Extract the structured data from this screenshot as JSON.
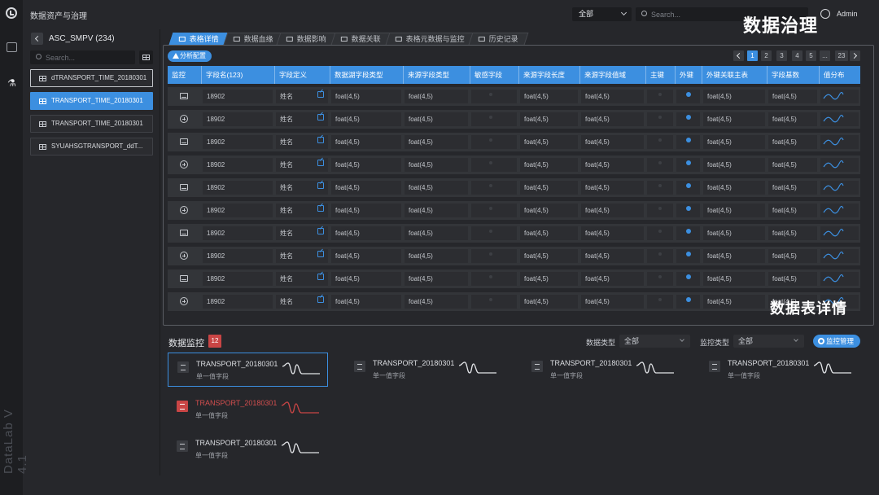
{
  "app": {
    "title": "数据资产与治理",
    "version": "DataLab V 4.1"
  },
  "header": {
    "scope": "全部",
    "search_placeholder": "Search...",
    "user": "Admin"
  },
  "overlay": {
    "title_main": "数据治理",
    "title_table": "数据表详情"
  },
  "sidebar": {
    "db_name": "ASC_SMPV (234)",
    "search_placeholder": "Search...",
    "tables": [
      {
        "name": "dTRANSPORT_TIME_20180301",
        "state": "outlined"
      },
      {
        "name": "TRANSPORT_TIME_20180301",
        "state": "selected"
      },
      {
        "name": "TRANSPORT_TIME_20180301",
        "state": "normal"
      },
      {
        "name": "SYUAHSGTRANSPORT_ddT...",
        "state": "normal"
      }
    ]
  },
  "tabs": [
    {
      "label": "表格详情",
      "active": true
    },
    {
      "label": "数据血缘",
      "active": false
    },
    {
      "label": "数据影响",
      "active": false
    },
    {
      "label": "数据关联",
      "active": false
    },
    {
      "label": "表格元数据与监控",
      "active": false
    },
    {
      "label": "历史记录",
      "active": false
    }
  ],
  "table": {
    "analyze_label": "分析配置",
    "pagination": {
      "pages": [
        "1",
        "2",
        "3",
        "4",
        "5",
        "...",
        "23"
      ],
      "current": "1"
    },
    "columns": [
      "监控",
      "字段名(123)",
      "字段定义",
      "数据湖字段类型",
      "来源字段类型",
      "敏感字段",
      "来源字段长度",
      "来源字段值域",
      "主键",
      "外键",
      "外键关联主表",
      "字段基数",
      "值分布"
    ],
    "rows": [
      {
        "icon": "image-icon",
        "field": "18902",
        "def": "姓名",
        "lake_type": "foat(4,5)",
        "src_type": "foat(4,5)",
        "src_len": "foat(4,5)",
        "src_range": "foat(4,5)",
        "fk_table": "foat(4,5)",
        "cardinality": "foat(4,5)"
      },
      {
        "icon": "plus-circle-icon",
        "field": "18902",
        "def": "姓名",
        "lake_type": "foat(4,5)",
        "src_type": "foat(4,5)",
        "src_len": "foat(4,5)",
        "src_range": "foat(4,5)",
        "fk_table": "foat(4,5)",
        "cardinality": "foat(4,5)"
      },
      {
        "icon": "image-icon",
        "field": "18902",
        "def": "姓名",
        "lake_type": "foat(4,5)",
        "src_type": "foat(4,5)",
        "src_len": "foat(4,5)",
        "src_range": "foat(4,5)",
        "fk_table": "foat(4,5)",
        "cardinality": "foat(4,5)"
      },
      {
        "icon": "plus-circle-icon",
        "field": "18902",
        "def": "姓名",
        "lake_type": "foat(4,5)",
        "src_type": "foat(4,5)",
        "src_len": "foat(4,5)",
        "src_range": "foat(4,5)",
        "fk_table": "foat(4,5)",
        "cardinality": "foat(4,5)"
      },
      {
        "icon": "image-icon",
        "field": "18902",
        "def": "姓名",
        "lake_type": "foat(4,5)",
        "src_type": "foat(4,5)",
        "src_len": "foat(4,5)",
        "src_range": "foat(4,5)",
        "fk_table": "foat(4,5)",
        "cardinality": "foat(4,5)"
      },
      {
        "icon": "plus-circle-icon",
        "field": "18902",
        "def": "姓名",
        "lake_type": "foat(4,5)",
        "src_type": "foat(4,5)",
        "src_len": "foat(4,5)",
        "src_range": "foat(4,5)",
        "fk_table": "foat(4,5)",
        "cardinality": "foat(4,5)"
      },
      {
        "icon": "image-icon",
        "field": "18902",
        "def": "姓名",
        "lake_type": "foat(4,5)",
        "src_type": "foat(4,5)",
        "src_len": "foat(4,5)",
        "src_range": "foat(4,5)",
        "fk_table": "foat(4,5)",
        "cardinality": "foat(4,5)"
      },
      {
        "icon": "plus-circle-icon",
        "field": "18902",
        "def": "姓名",
        "lake_type": "foat(4,5)",
        "src_type": "foat(4,5)",
        "src_len": "foat(4,5)",
        "src_range": "foat(4,5)",
        "fk_table": "foat(4,5)",
        "cardinality": "foat(4,5)"
      },
      {
        "icon": "image-icon",
        "field": "18902",
        "def": "姓名",
        "lake_type": "foat(4,5)",
        "src_type": "foat(4,5)",
        "src_len": "foat(4,5)",
        "src_range": "foat(4,5)",
        "fk_table": "foat(4,5)",
        "cardinality": "foat(4,5)"
      },
      {
        "icon": "plus-circle-icon",
        "field": "18902",
        "def": "姓名",
        "lake_type": "foat(4,5)",
        "src_type": "foat(4,5)",
        "src_len": "foat(4,5)",
        "src_range": "foat(4,5)",
        "fk_table": "foat(4,5)",
        "cardinality": "foat(4,5)"
      }
    ]
  },
  "monitor": {
    "title": "数据监控",
    "count": "12",
    "filter_data_type_label": "数据类型",
    "filter_data_type_value": "全部",
    "filter_monitor_type_label": "监控类型",
    "filter_monitor_type_value": "全部",
    "manage_label": "监控管理",
    "cards": [
      {
        "name": "TRANSPORT_20180301",
        "sub": "单一值字段",
        "state": "outlined"
      },
      {
        "name": "TRANSPORT_20180301",
        "sub": "单一值字段",
        "state": "normal"
      },
      {
        "name": "TRANSPORT_20180301",
        "sub": "单一值字段",
        "state": "normal"
      },
      {
        "name": "TRANSPORT_20180301",
        "sub": "单一值字段",
        "state": "normal"
      },
      {
        "name": "TRANSPORT_20180301",
        "sub": "单一值字段",
        "state": "alert"
      },
      {
        "name": "TRANSPORT_20180301",
        "sub": "单一值字段",
        "state": "normal"
      }
    ]
  },
  "colors": {
    "accent": "#3c8fe0",
    "alert": "#c94545",
    "background": "#26272b"
  }
}
